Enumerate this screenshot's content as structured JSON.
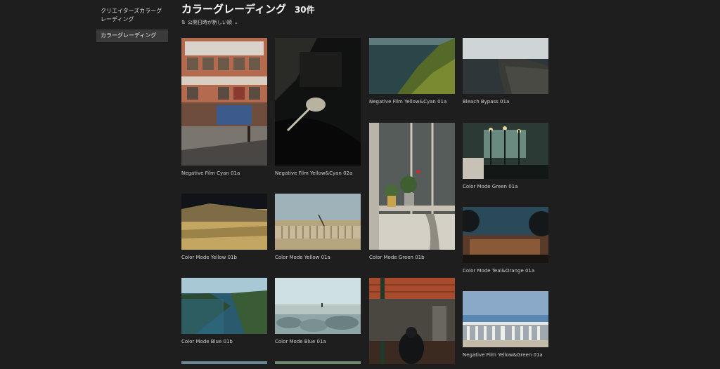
{
  "sidebar": {
    "items": [
      {
        "label": "クリエイターズカラーグレーディング",
        "active": false
      },
      {
        "label": "カラーグレーディング",
        "active": true
      }
    ]
  },
  "header": {
    "title": "カラーグレーディング",
    "count": "30件",
    "sort_label": "公開日時が新しい順"
  },
  "cards": [
    {
      "title": "Negative Film Cyan 01a",
      "icon": "street-photo"
    },
    {
      "title": "Negative Film Yellow&Cyan 02a",
      "icon": "car-mirror-photo"
    },
    {
      "title": "Negative Film Yellow&Cyan 01a",
      "icon": "coast-photo"
    },
    {
      "title": "Bleach Bypass 01a",
      "icon": "cliff-sea-photo"
    },
    {
      "title": "Color Mode Green 01a",
      "icon": "cafe-photo"
    },
    {
      "title": "Color Mode Green 01b",
      "icon": "window-plants-photo"
    },
    {
      "title": "Color Mode Yellow 01b",
      "icon": "grass-photo"
    },
    {
      "title": "Color Mode Yellow 01a",
      "icon": "beach-fence-photo"
    },
    {
      "title": "Color Mode Teal&Orange 01a",
      "icon": "dusk-building-photo"
    },
    {
      "title": "Color Mode Blue 01b",
      "icon": "river-photo"
    },
    {
      "title": "Color Mode Blue 01a",
      "icon": "rocky-shore-photo"
    },
    {
      "title": "Negative Film Yellow&Green 01a",
      "icon": "balustrade-sea-photo"
    },
    {
      "title": "",
      "icon": "market-hall-photo"
    }
  ]
}
